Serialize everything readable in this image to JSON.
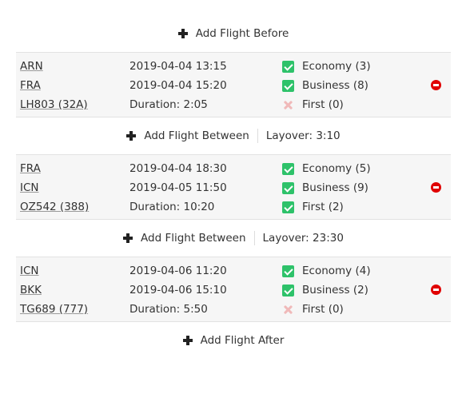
{
  "add_before": {
    "label": "Add Flight Before"
  },
  "add_after": {
    "label": "Add Flight After"
  },
  "flights": [
    {
      "from": "ARN",
      "to": "FRA",
      "flight_no": "LH803 (32A)",
      "depart": "2019-04-04 13:15",
      "arrive": "2019-04-04 15:20",
      "duration": "Duration: 2:05",
      "cabins": [
        {
          "label": "Economy (3)",
          "available": true
        },
        {
          "label": "Business (8)",
          "available": true
        },
        {
          "label": "First (0)",
          "available": false
        }
      ]
    },
    {
      "from": "FRA",
      "to": "ICN",
      "flight_no": "OZ542 (388)",
      "depart": "2019-04-04 18:30",
      "arrive": "2019-04-05 11:50",
      "duration": "Duration: 10:20",
      "cabins": [
        {
          "label": "Economy (5)",
          "available": true
        },
        {
          "label": "Business (9)",
          "available": true
        },
        {
          "label": "First (2)",
          "available": true
        }
      ]
    },
    {
      "from": "ICN",
      "to": "BKK",
      "flight_no": "TG689 (777)",
      "depart": "2019-04-06 11:20",
      "arrive": "2019-04-06 15:10",
      "duration": "Duration: 5:50",
      "cabins": [
        {
          "label": "Economy (4)",
          "available": true
        },
        {
          "label": "Business (2)",
          "available": true
        },
        {
          "label": "First (0)",
          "available": false
        }
      ]
    }
  ],
  "between": [
    {
      "label": "Add Flight Between",
      "layover": "Layover: 3:10"
    },
    {
      "label": "Add Flight Between",
      "layover": "Layover: 23:30"
    }
  ],
  "colors": {
    "check": "#2ec26a",
    "unavailable": "#f0b9b9",
    "remove": "#e00000",
    "row_bg": "#f6f6f6"
  }
}
